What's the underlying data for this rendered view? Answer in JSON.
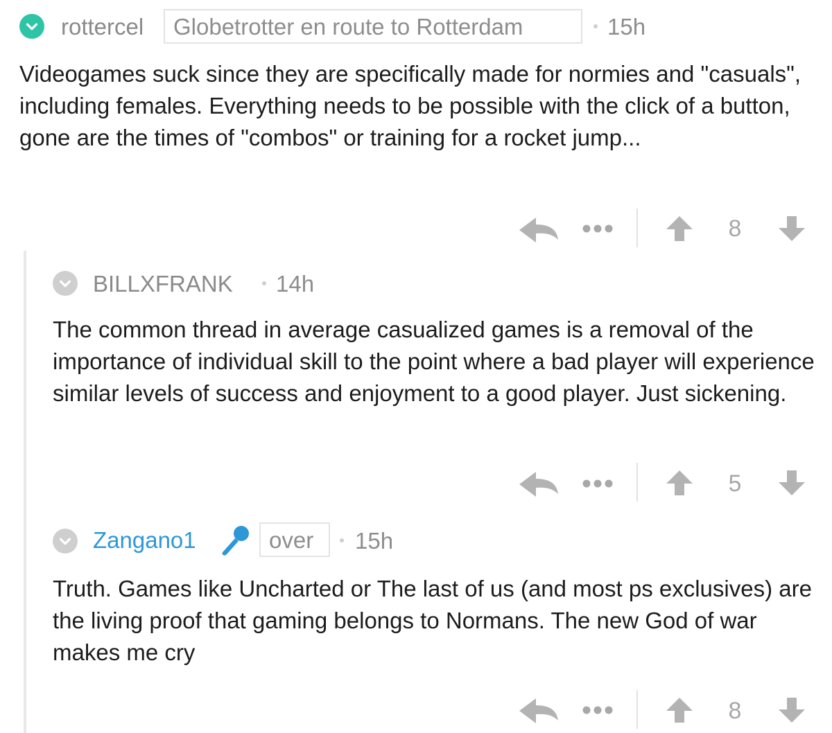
{
  "colors": {
    "accent_green": "#2ec4a6",
    "username_blue": "#2e97d8",
    "muted_gray": "#8d8d8d",
    "icon_gray": "#a8a8a8"
  },
  "comments": [
    {
      "username": "rottercel",
      "flair": "Globetrotter en route to Rotterdam",
      "time": "15h",
      "body": "Videogames suck since they are specifically made for normies and \"casuals\", including females. Everything needs to be possible with the click of a button, gone are the times of \"combos\" or training for a rocket jump...",
      "score": "8",
      "collapse_icon": "chevron-down-icon"
    },
    {
      "username": "BILLXFRANK",
      "time": "14h",
      "body": "The common thread in average casualized games is a removal of the importance of individual skill to the point where a bad player will experience similar levels of success and enjoyment to a good player. Just sickening.",
      "score": "5",
      "collapse_icon": "chevron-down-icon"
    },
    {
      "username": "Zangano1",
      "badge_icon": "microphone-icon",
      "flair": "over",
      "time": "15h",
      "body": "Truth. Games like Uncharted or The last of us (and most ps exclusives) are the living proof that gaming belongs to Normans. The new God of war makes me cry",
      "score": "8",
      "collapse_icon": "chevron-down-icon"
    }
  ],
  "actions": {
    "reply_icon": "reply-icon",
    "more_icon": "more-icon",
    "upvote_icon": "upvote-icon",
    "downvote_icon": "downvote-icon"
  }
}
